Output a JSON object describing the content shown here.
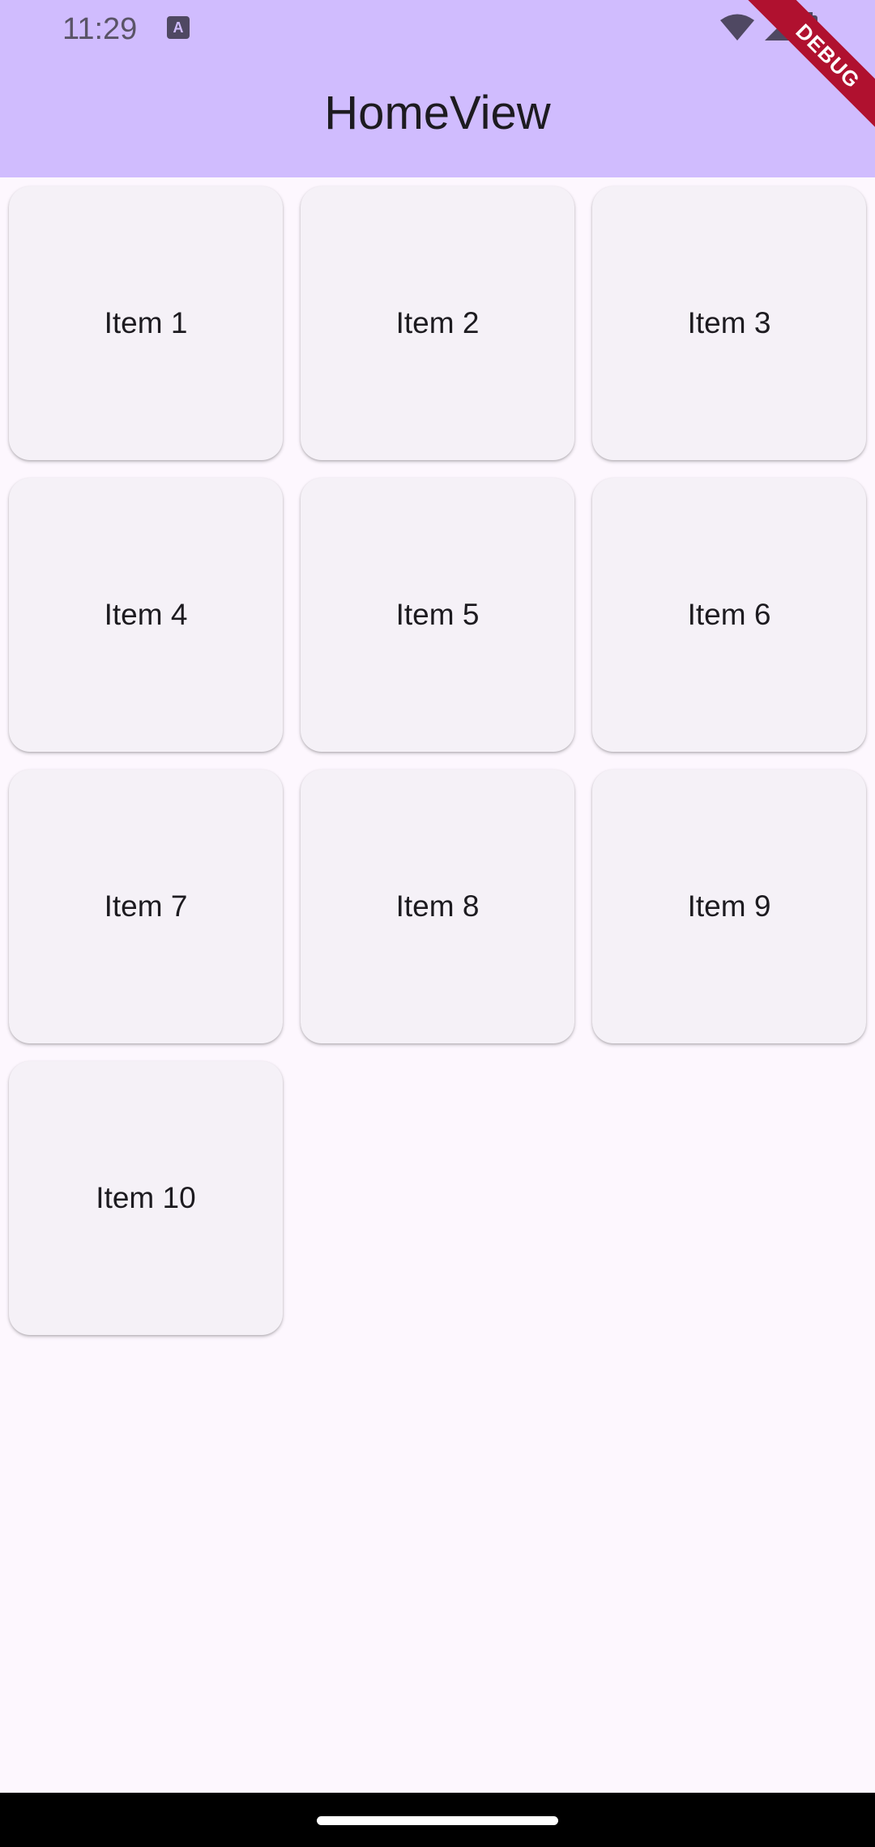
{
  "status_bar": {
    "time": "11:29",
    "notification_icon": "a-letter-icon",
    "notification_glyph": "A",
    "icons": [
      "wifi-icon",
      "signal-icon",
      "battery-icon"
    ]
  },
  "app_bar": {
    "title": "HomeView",
    "color": "#d0bcfe"
  },
  "debug_banner": {
    "label": "DEBUG",
    "color": "#b0112f"
  },
  "grid": {
    "items": [
      {
        "label": "Item 1"
      },
      {
        "label": "Item 2"
      },
      {
        "label": "Item 3"
      },
      {
        "label": "Item 4"
      },
      {
        "label": "Item 5"
      },
      {
        "label": "Item 6"
      },
      {
        "label": "Item 7"
      },
      {
        "label": "Item 8"
      },
      {
        "label": "Item 9"
      },
      {
        "label": "Item 10"
      }
    ]
  },
  "colors": {
    "background": "#fdf7fe",
    "tile": "#f5f1f7",
    "text": "#1d1b20"
  }
}
